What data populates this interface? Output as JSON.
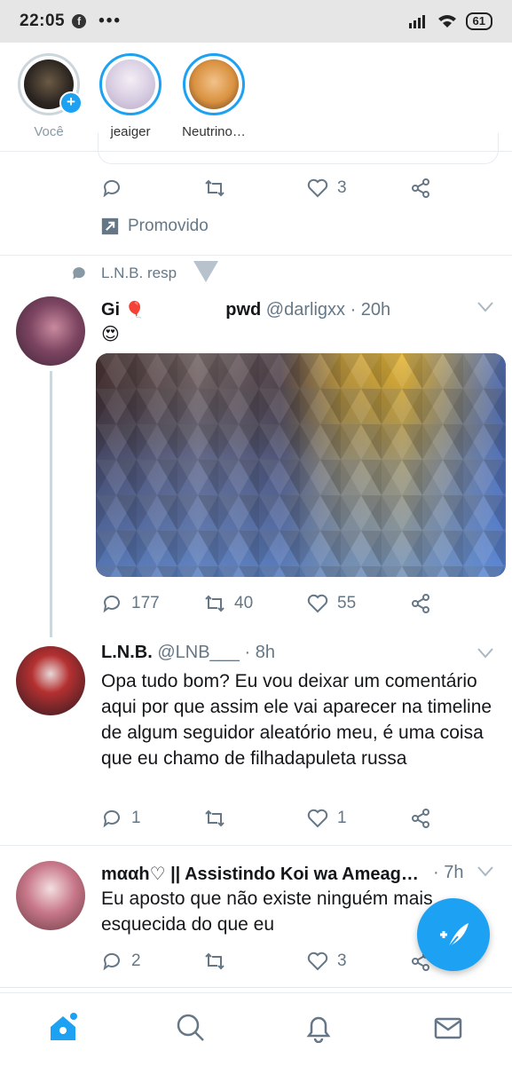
{
  "status_bar": {
    "time": "22:05",
    "battery": "61"
  },
  "fleets": [
    {
      "label": "Você",
      "muted": true
    },
    {
      "label": "jeaiger",
      "muted": false
    },
    {
      "label": "Neutrino…",
      "muted": false
    }
  ],
  "promo_tweet": {
    "like_count": "3",
    "promoted_label": "Promovido"
  },
  "retweet_context": "L.N.B. resp",
  "tweet_gi": {
    "name": "Gi",
    "name_suffix": "pwd",
    "handle": "@darligxx",
    "time": "· 20h",
    "reply_count": "177",
    "retweet_count": "40",
    "like_count": "55"
  },
  "tweet_lnb": {
    "name": "L.N.B.",
    "handle": "@LNB___",
    "time": "· 8h",
    "text": "Opa tudo bom? Eu vou deixar um comentário aqui por que assim ele vai aparecer na timeline de algum seguidor aleatório meu, é uma coisa que eu chamo de filhadapuleta russa",
    "reply_count": "1",
    "like_count": "1"
  },
  "tweet_maah": {
    "name": "mααh♡ || Assistindo Koi wa Ameag…",
    "time": "· 7h",
    "text": "Eu aposto que não existe ninguém mais esquecida do que eu",
    "reply_count": "2",
    "like_count": "3"
  },
  "colors": {
    "accent": "#1da1f2",
    "muted": "#657786"
  },
  "icons": [
    "facebook-icon",
    "wifi-icon",
    "signal-icon",
    "reply-icon",
    "retweet-icon",
    "like-icon",
    "share-icon",
    "promoted-icon",
    "home-icon",
    "search-icon",
    "notifications-icon",
    "messages-icon",
    "compose-icon"
  ]
}
